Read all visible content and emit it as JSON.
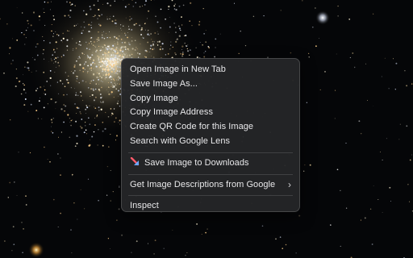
{
  "context_menu": {
    "items": [
      {
        "label": "Open Image in New Tab"
      },
      {
        "label": "Save Image As..."
      },
      {
        "label": "Copy Image"
      },
      {
        "label": "Copy Image Address"
      },
      {
        "label": "Create QR Code for this Image"
      },
      {
        "label": "Search with Google Lens"
      }
    ],
    "extension_item": {
      "label": "Save Image to Downloads",
      "icon": "download-arrow-icon"
    },
    "submenu_item": {
      "label": "Get Image Descriptions from Google",
      "chevron": "›"
    },
    "inspect_item": {
      "label": "Inspect"
    }
  }
}
